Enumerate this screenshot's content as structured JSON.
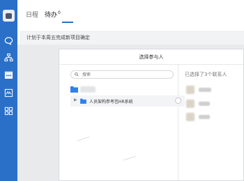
{
  "sidebar": {
    "icons": [
      "chat-icon",
      "org-icon",
      "calendar-icon",
      "document-icon",
      "apps-icon"
    ]
  },
  "nav": {
    "tabs": [
      {
        "label": "日程"
      },
      {
        "label": "待办",
        "badge": "0"
      }
    ]
  },
  "task": {
    "text": "计划于本周五完成新项目确定"
  },
  "dialog": {
    "title": "选择参与人",
    "search": {
      "placeholder": "搜索"
    },
    "department": {
      "label": "人员架构参考芭HR系统"
    },
    "selected_text": "已选择了3个联系人"
  },
  "colors": {
    "sidebar": "#2a6fc8",
    "folder": "#2f80ed",
    "overlay": "#e9eaec"
  }
}
